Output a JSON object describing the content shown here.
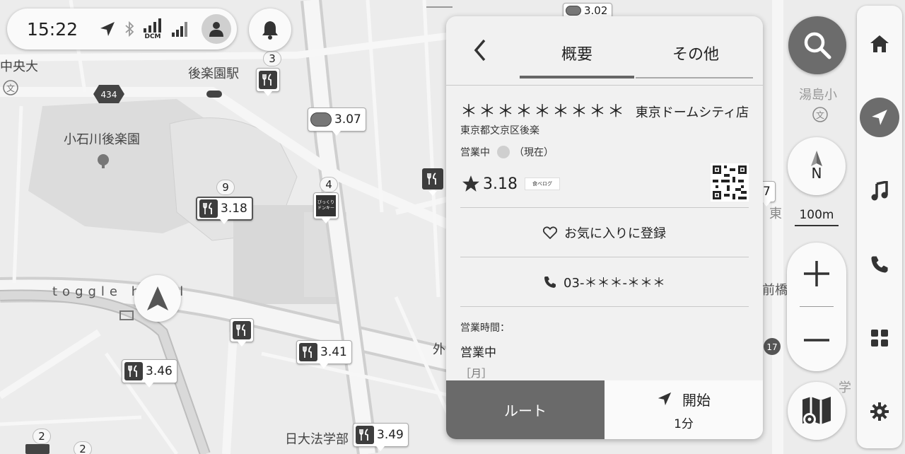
{
  "status": {
    "time": "15:22",
    "carrier": "DCM"
  },
  "map": {
    "labels": {
      "chuodai": "中央大",
      "korakuen_station": "後楽園駅",
      "koishikawa": "小石川後楽園",
      "hotel": "toggle hotel",
      "nichidai": "日大法学部",
      "yushima": "湯島小",
      "sotobori": "外",
      "maebashi": "前橋",
      "higashi": "東",
      "gaku": "学",
      "route_434": "434",
      "route_17": "17"
    },
    "pois": [
      {
        "value": "3.07"
      },
      {
        "value": "3.18"
      },
      {
        "value": "3.41"
      },
      {
        "value": "3.46"
      },
      {
        "value": "3.49"
      },
      {
        "value": "3.02"
      },
      {
        "value": "7"
      }
    ],
    "clusters": [
      "3",
      "9",
      "4",
      "2",
      "2"
    ],
    "donki_text": "びっくりドンキー"
  },
  "panel": {
    "tab_overview": "概要",
    "tab_other": "その他",
    "stars": "＊＊＊＊＊＊＊＊＊",
    "store": "東京ドームシティ店",
    "address": "東京都文京区後楽",
    "open_status": "営業中",
    "open_now": "（現在）",
    "rating": "3.18",
    "tabelog": "食べログ",
    "favorite": "お気に入りに登録",
    "phone": "03-＊＊＊-＊＊＊",
    "hours_label": "営業時間：",
    "hours_value": "営業中",
    "hours_day": "［月］",
    "route": "ルート",
    "start": "開始",
    "duration": "1分"
  },
  "controls": {
    "compass_label": "N",
    "scale": "100m"
  },
  "colors": {
    "accent": "#6c6c6c",
    "panel": "#f1f1f1",
    "map": "#ececec"
  }
}
